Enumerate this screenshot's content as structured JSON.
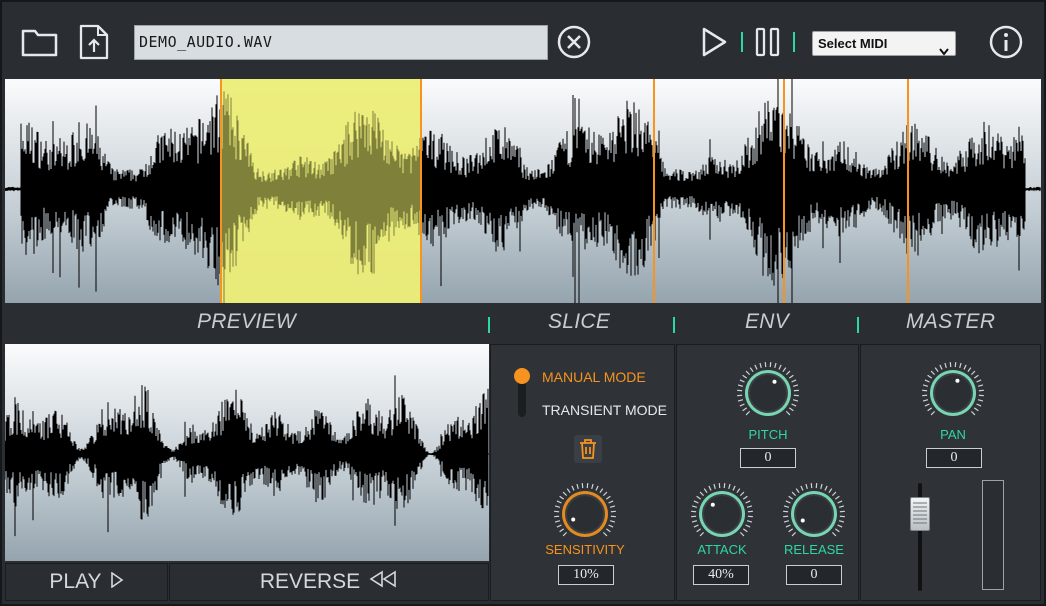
{
  "toolbar": {
    "filename": "DEMO_AUDIO.WAV",
    "midi_select_value": "Select MIDI",
    "accent_color": "#2fd6a7"
  },
  "sections": {
    "preview": "PREVIEW",
    "slice": "SLICE",
    "env": "ENV",
    "master": "MASTER"
  },
  "preview_buttons": {
    "play": "PLAY",
    "reverse": "REVERSE"
  },
  "slice": {
    "manual_mode": "MANUAL MODE",
    "transient_mode": "TRANSIENT MODE",
    "sensitivity_label": "SENSITIVITY",
    "sensitivity_value": "10%",
    "active_color": "#f7931e"
  },
  "env": {
    "pitch_label": "PITCH",
    "pitch_value": "0",
    "attack_label": "ATTACK",
    "attack_value": "40%",
    "release_label": "RELEASE",
    "release_value": "0",
    "label_color": "#2fd6a7"
  },
  "master": {
    "pan_label": "PAN",
    "pan_value": "0"
  }
}
